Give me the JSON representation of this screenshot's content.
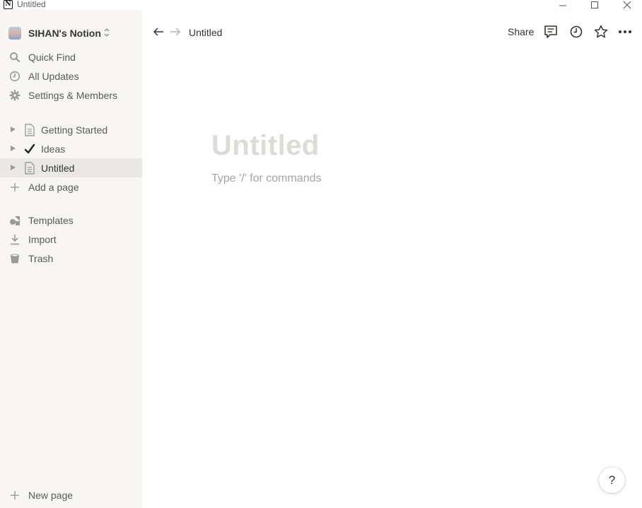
{
  "window": {
    "title": "Untitled",
    "logo_letter": "N"
  },
  "sidebar": {
    "workspace_name": "SIHAN's Notion",
    "top_items": [
      {
        "label": "Quick Find",
        "icon": "search-icon"
      },
      {
        "label": "All Updates",
        "icon": "clock-icon"
      },
      {
        "label": "Settings & Members",
        "icon": "gear-icon"
      }
    ],
    "pages": [
      {
        "label": "Getting Started",
        "icon": "page-icon",
        "selected": false
      },
      {
        "label": "Ideas",
        "icon": "checkmark-icon",
        "selected": false
      },
      {
        "label": "Untitled",
        "icon": "page-icon",
        "selected": true
      }
    ],
    "add_page_label": "Add a page",
    "bottom_items": [
      {
        "label": "Templates",
        "icon": "shapes-icon"
      },
      {
        "label": "Import",
        "icon": "download-icon"
      },
      {
        "label": "Trash",
        "icon": "trash-icon"
      }
    ],
    "new_page_label": "New page"
  },
  "topbar": {
    "breadcrumb": "Untitled",
    "share_label": "Share"
  },
  "document": {
    "title_placeholder": "Untitled",
    "body_placeholder": "Type '/' for commands"
  },
  "help_label": "?",
  "colors": {
    "sidebar_bg": "#f7f6f3",
    "selected_bg": "#e9e8e5",
    "text": "#37352f",
    "muted_text": "#5a5955",
    "title_placeholder": "#dcdbd8"
  }
}
